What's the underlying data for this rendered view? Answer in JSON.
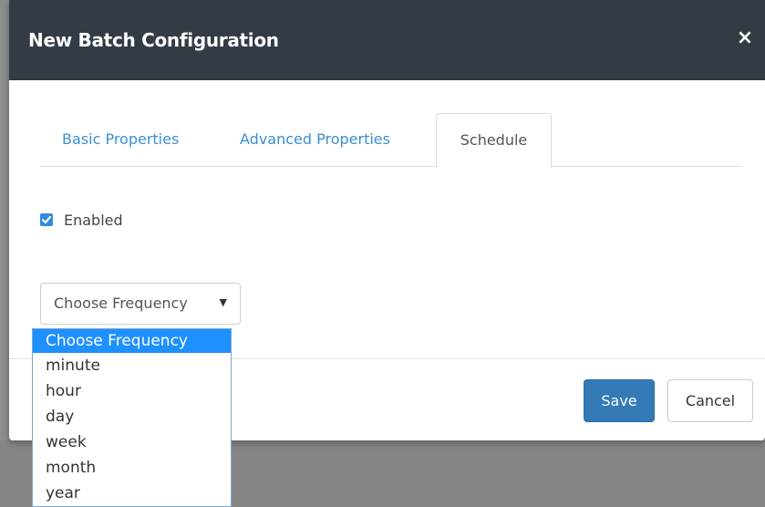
{
  "modal": {
    "title": "New Batch Configuration",
    "close_icon": "×"
  },
  "tabs": [
    {
      "label": "Basic Properties",
      "active": false
    },
    {
      "label": "Advanced Properties",
      "active": false
    },
    {
      "label": "Schedule",
      "active": true
    }
  ],
  "schedule": {
    "enabled_label": "Enabled",
    "enabled_checked": true,
    "frequency": {
      "selected": "Choose Frequency",
      "caret": "▼",
      "options": [
        "Choose Frequency",
        "minute",
        "hour",
        "day",
        "week",
        "month",
        "year"
      ],
      "highlighted_index": 0
    }
  },
  "footer": {
    "save_label": "Save",
    "cancel_label": "Cancel"
  },
  "colors": {
    "header_bg": "#333b44",
    "link": "#3a8fd0",
    "primary": "#337ab7",
    "highlight": "#1e90ff"
  }
}
